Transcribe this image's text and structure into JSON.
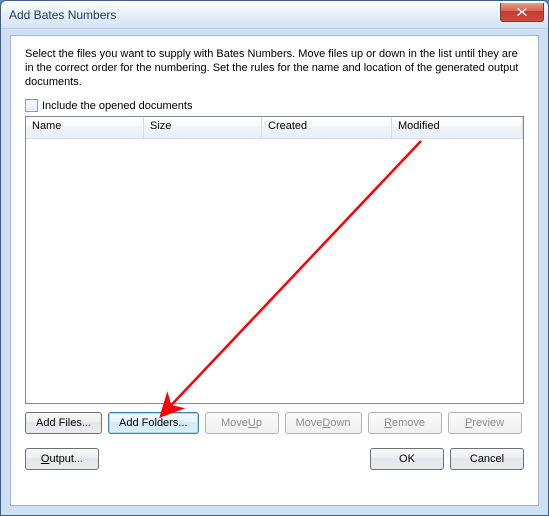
{
  "title": "Add Bates Numbers",
  "instruction": "Select the files you want to supply with Bates Numbers. Move files up or down in the list until they are in the correct order for the numbering. Set the rules for the name and location of the generated output documents.",
  "checkbox": {
    "label": "Include the opened documents",
    "checked": false
  },
  "columns": {
    "name": "Name",
    "size": "Size",
    "created": "Created",
    "modified": "Modified"
  },
  "buttons": {
    "add_files": "Add Files...",
    "add_folders": "Add Folders...",
    "move_up": "Move Up",
    "move_down": "Move Down",
    "remove": "Remove",
    "preview": "Preview",
    "output": "Output...",
    "ok": "OK",
    "cancel": "Cancel"
  },
  "underline": {
    "move_up": "U",
    "move_down": "D",
    "remove": "R",
    "preview": "P",
    "output": "O"
  }
}
